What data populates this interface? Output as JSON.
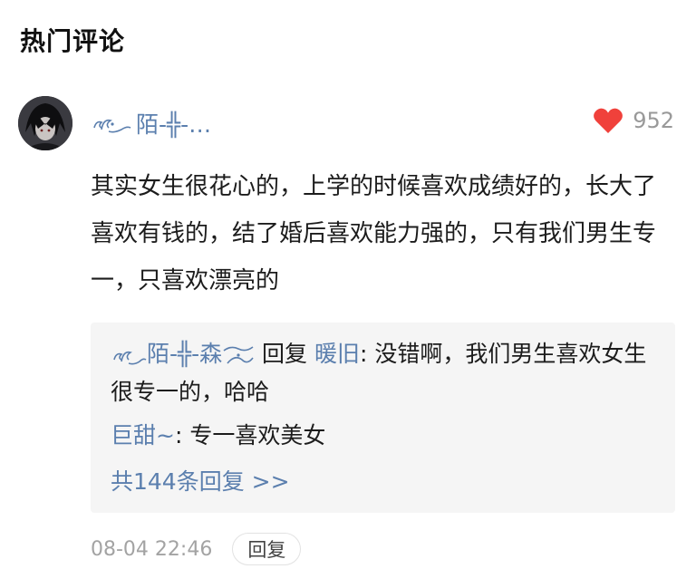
{
  "section": {
    "title": "热门评论"
  },
  "comment": {
    "username": "陌-╬-…",
    "likes": "952",
    "body": "其实女生很花心的，上学的时候喜欢成绩好的，长大了喜欢有钱的，结了婚后喜欢能力强的，只有我们男生专一，只喜欢漂亮的",
    "timestamp": "08-04 22:46",
    "reply_button": "回复",
    "icons": {
      "like": "heart-icon",
      "avatar": "avatar-image"
    },
    "colors": {
      "link": "#5b7fae",
      "heart": "#f0413b"
    }
  },
  "replies": {
    "items": [
      {
        "author": "陌-╬-森",
        "action": " 回复 ",
        "target": "暖旧",
        "text": ": 没错啊，我们男生喜欢女生很专一的，哈哈"
      },
      {
        "author": "巨甜~",
        "text": ": 专一喜欢美女"
      }
    ],
    "more": "共144条回复 >>"
  }
}
